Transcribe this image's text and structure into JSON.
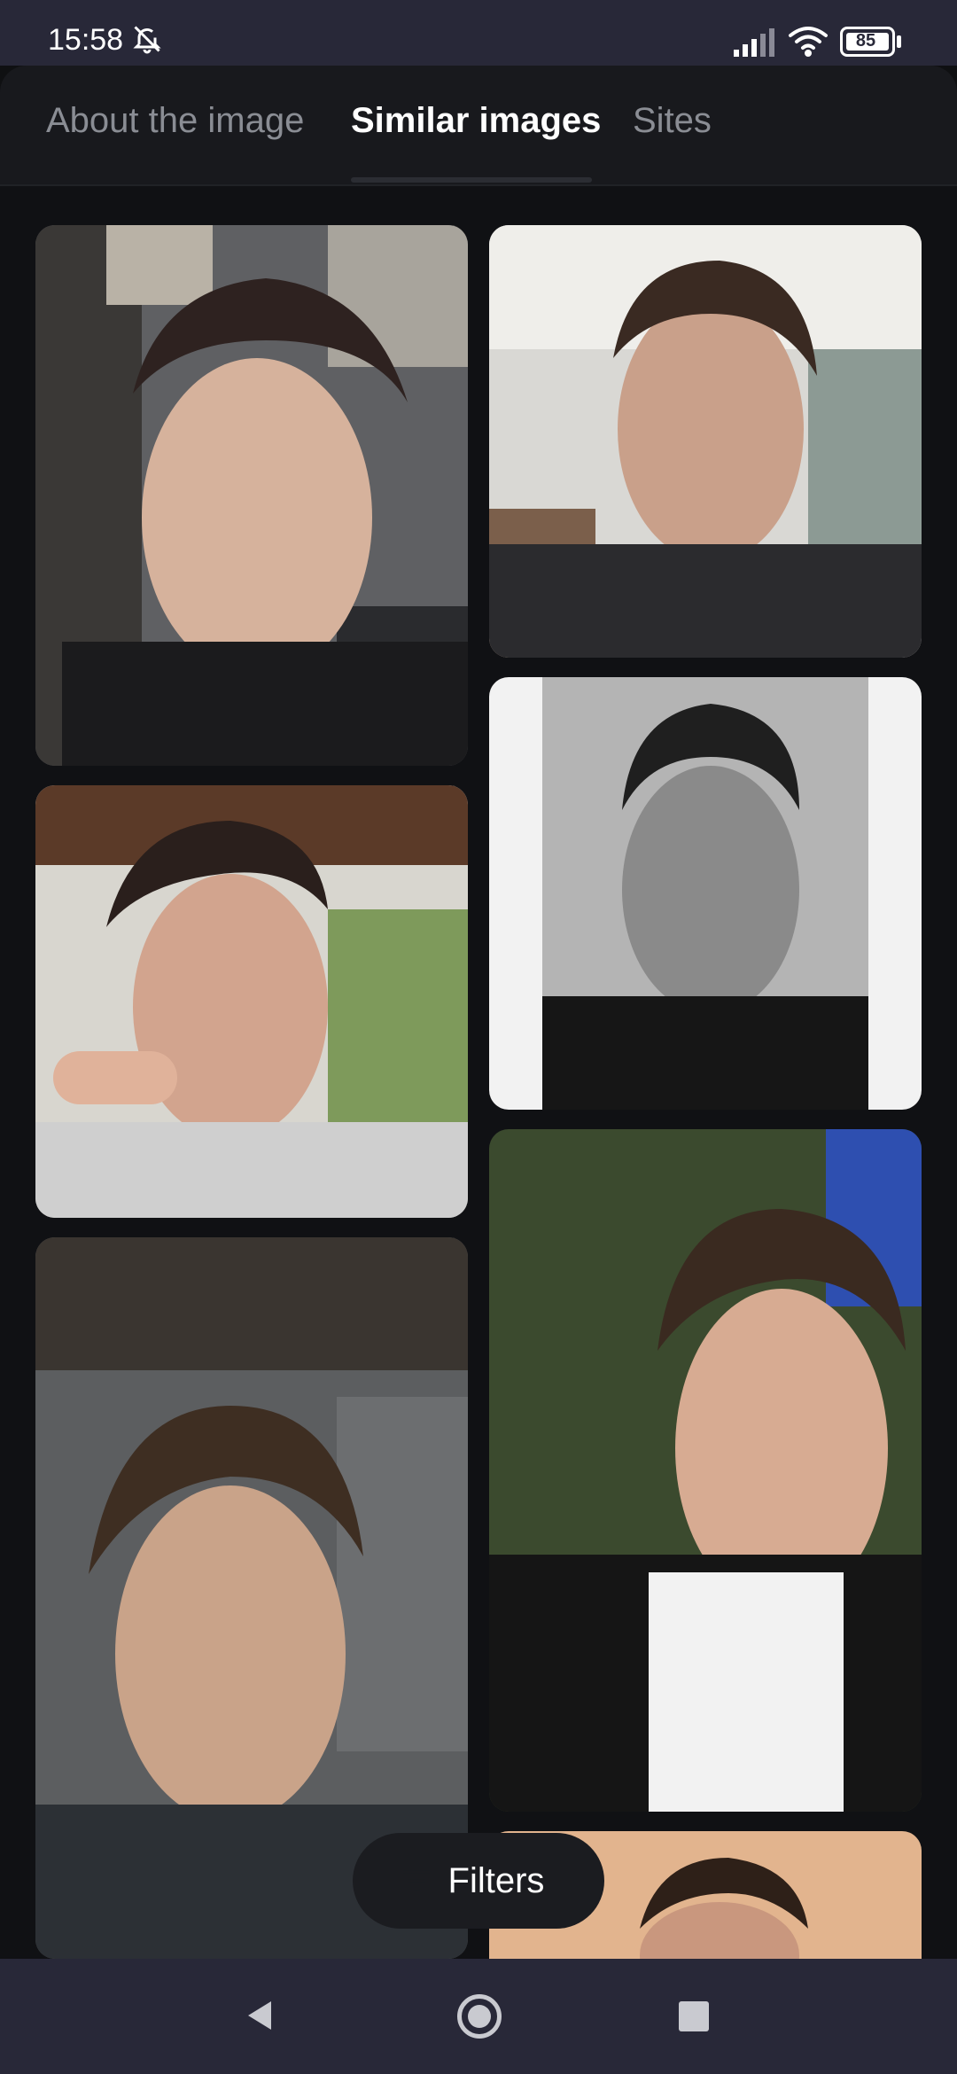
{
  "status_bar": {
    "time": "15:58",
    "battery_level": "85",
    "icons": [
      "bell-off-icon",
      "signal-icon",
      "wifi-icon",
      "battery-icon"
    ]
  },
  "tabs": [
    {
      "label": "About the image",
      "active": false
    },
    {
      "label": "Similar images",
      "active": true
    },
    {
      "label": "Sites",
      "active": false
    }
  ],
  "results": {
    "image_count_visible": 7,
    "accent": "#ffffff"
  },
  "filters": {
    "label": "Filters",
    "icon": "filter-icon"
  },
  "navigation": {
    "icons": [
      "back-icon",
      "home-icon",
      "recents-icon"
    ]
  }
}
